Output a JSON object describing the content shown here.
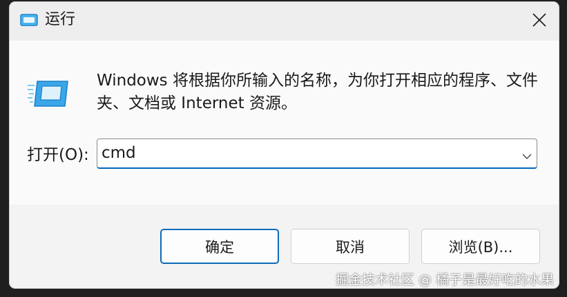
{
  "window": {
    "title": "运行",
    "close_icon": "close-icon"
  },
  "content": {
    "icon": "run-icon",
    "description": "Windows 将根据你所输入的名称，为你打开相应的程序、文件夹、文档或 Internet 资源。",
    "open_label": "打开(O):",
    "open_value": "cmd",
    "dropdown_icon": "chevron-down-icon"
  },
  "buttons": {
    "ok": "确定",
    "cancel": "取消",
    "browse": "浏览(B)..."
  },
  "watermark": "掘金技术社区 @ 橘子是最好吃的水果",
  "colors": {
    "accent": "#0067c0",
    "icon_blue": "#3aa7e8"
  }
}
